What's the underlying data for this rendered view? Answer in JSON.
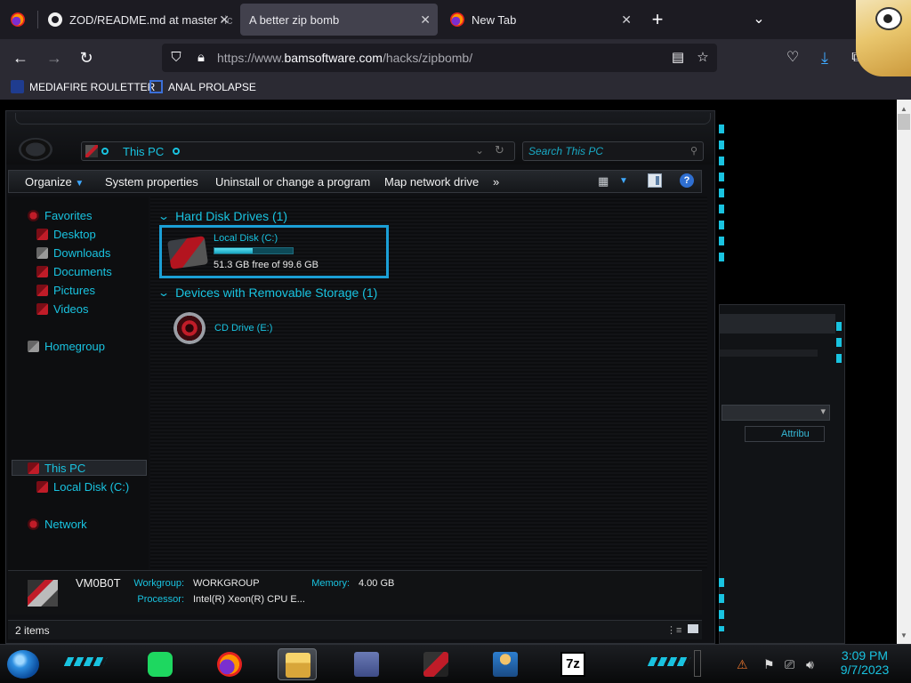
{
  "tabs": [
    {
      "title": "ZOD/README.md at master · ",
      "suffix": "ic",
      "icon": "github-icon",
      "active": false
    },
    {
      "title": "A better zip bomb",
      "icon": "none",
      "active": true
    },
    {
      "title": "New Tab",
      "icon": "firefox-icon",
      "active": false
    }
  ],
  "newtab_label": "+",
  "navbar": {
    "url_prefix": "https://www.",
    "url_host": "bamsoftware.com",
    "url_path": "/hacks/zipbomb/"
  },
  "bookmarks": [
    {
      "label": "MEDIAFIRE ROULETTER",
      "icon": "mediafire-icon"
    },
    {
      "label": "ANAL PROLAPSE",
      "icon": "bookmark-icon"
    }
  ],
  "explorer": {
    "address": "This PC",
    "search_placeholder": "Search This PC",
    "toolbar": {
      "organize": "Organize",
      "system_properties": "System properties",
      "uninstall": "Uninstall or change a program",
      "map_drive": "Map network drive",
      "more": "»"
    },
    "nav": {
      "favorites": "Favorites",
      "desktop": "Desktop",
      "downloads": "Downloads",
      "documents": "Documents",
      "pictures": "Pictures",
      "videos": "Videos",
      "homegroup": "Homegroup",
      "this_pc": "This PC",
      "local_disk": "Local Disk (C:)",
      "network": "Network"
    },
    "groups": {
      "hdd": "Hard Disk Drives (1)",
      "removable": "Devices with Removable Storage (1)"
    },
    "drive_c": {
      "name": "Local Disk (C:)",
      "free_text": "51.3 GB free of 99.6 GB",
      "used_fraction": 0.485
    },
    "cd_drive": "CD Drive (E:)",
    "details": {
      "computer_name": "VM0B0T",
      "workgroup_label": "Workgroup:",
      "workgroup": "WORKGROUP",
      "memory_label": "Memory:",
      "memory": "4.00 GB",
      "processor_label": "Processor:",
      "processor": "Intel(R) Xeon(R) CPU E..."
    },
    "status_items": "2 items"
  },
  "background_window": {
    "column_header": "Attribu"
  },
  "taskbar": {
    "time": "3:09 PM",
    "date": "9/7/2023",
    "apps": [
      "spotify-icon",
      "firefox-icon",
      "file-explorer-icon",
      "control-panel-icon",
      "graphics-card-icon",
      "network-user-icon",
      "7zip-icon"
    ],
    "sevenzip_label": "7z"
  },
  "colors": {
    "accent": "#19c3e0",
    "selection_border": "#1b9fd6",
    "theme_red": "#c01c28",
    "browser_bg": "#1c1b22"
  }
}
